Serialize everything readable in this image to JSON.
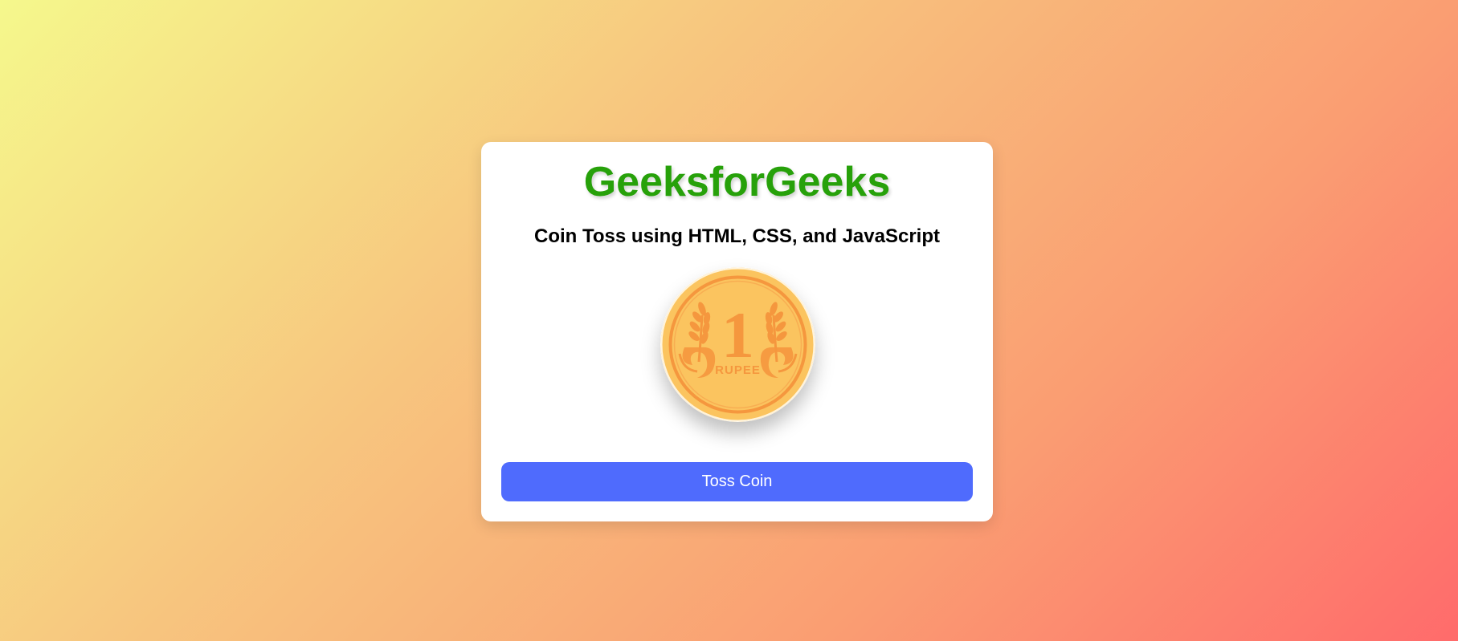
{
  "header": {
    "brand": "GeeksforGeeks",
    "subtitle": "Coin Toss using HTML, CSS, and JavaScript"
  },
  "coin": {
    "face_value": "1",
    "face_label": "RUPEE",
    "icon": "rupee-coin-icon",
    "colors": {
      "body": "#fbc45f",
      "engraving": "#f5973e"
    }
  },
  "actions": {
    "toss_label": "Toss Coin"
  },
  "colors": {
    "brand": "#27a10a",
    "button": "#4f6bfd",
    "gradient_start": "#f5f88c",
    "gradient_end": "#ff6b6b"
  }
}
